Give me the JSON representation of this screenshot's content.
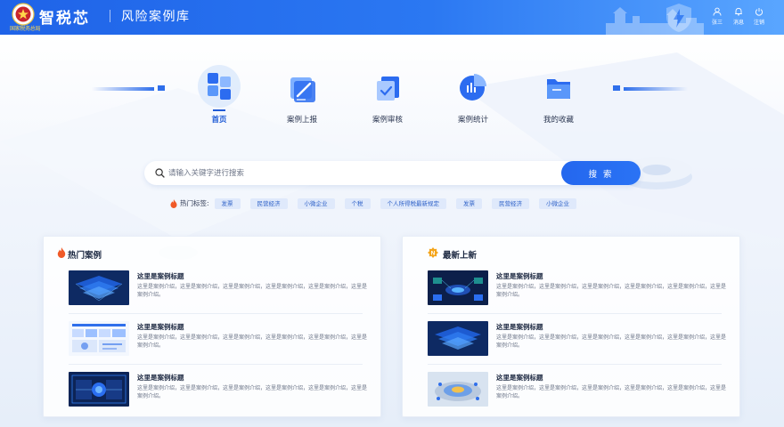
{
  "header": {
    "emblem_text": "税徽",
    "emblem_sub": "国家税务总局",
    "brand": "智税芯",
    "subtitle": "风险案例库",
    "actions": [
      {
        "label": "张三",
        "icon": "user-icon"
      },
      {
        "label": "消息",
        "icon": "bell-icon"
      },
      {
        "label": "注销",
        "icon": "power-icon"
      }
    ]
  },
  "nav": {
    "items": [
      {
        "label": "首页",
        "icon": "home-grid-icon",
        "active": true
      },
      {
        "label": "案例上报",
        "icon": "edit-document-icon",
        "active": false
      },
      {
        "label": "案例审核",
        "icon": "review-check-icon",
        "active": false
      },
      {
        "label": "案例统计",
        "icon": "pie-chart-icon",
        "active": false
      },
      {
        "label": "我的收藏",
        "icon": "folder-icon",
        "active": false
      }
    ]
  },
  "search": {
    "placeholder": "请输入关键字进行搜索",
    "value": "",
    "button_label": "搜 索"
  },
  "hot_tags": {
    "label": "热门标签:",
    "tags": [
      "发票",
      "民营经济",
      "小微企业",
      "个税",
      "个人所得税最新规定",
      "发票",
      "民营经济",
      "小微企业"
    ]
  },
  "panels": {
    "hot": {
      "title": "热门案例",
      "icon": "flame-icon",
      "cases": [
        {
          "title": "这里是案例标题",
          "desc": "这里是案例介绍，这里是案例介绍，这里是案例介绍，这里是案例介绍，这里是案例介绍，这里是案例介绍。"
        },
        {
          "title": "这里是案例标题",
          "desc": "这里是案例介绍，这里是案例介绍，这里是案例介绍，这里是案例介绍，这里是案例介绍，这里是案例介绍。"
        },
        {
          "title": "这里是案例标题",
          "desc": "这里是案例介绍，这里是案例介绍，这里是案例介绍，这里是案例介绍，这里是案例介绍，这里是案例介绍。"
        }
      ]
    },
    "latest": {
      "title": "最新上新",
      "icon": "new-badge-icon",
      "badge": "N",
      "cases": [
        {
          "title": "这里是案例标题",
          "desc": "这里是案例介绍，这里是案例介绍，这里是案例介绍，这里是案例介绍，这里是案例介绍，这里是案例介绍。"
        },
        {
          "title": "这里是案例标题",
          "desc": "这里是案例介绍，这里是案例介绍，这里是案例介绍，这里是案例介绍，这里是案例介绍，这里是案例介绍。"
        },
        {
          "title": "这里是案例标题",
          "desc": "这里是案例介绍，这里是案例介绍，这里是案例介绍，这里是案例介绍，这里是案例介绍，这里是案例介绍。"
        }
      ]
    }
  },
  "colors": {
    "brand_blue": "#1f63e8",
    "accent": "#1f5bd6",
    "tag_bg": "#dfe9fb",
    "new_badge": "#f4a51c",
    "flame": "#f05a28"
  }
}
